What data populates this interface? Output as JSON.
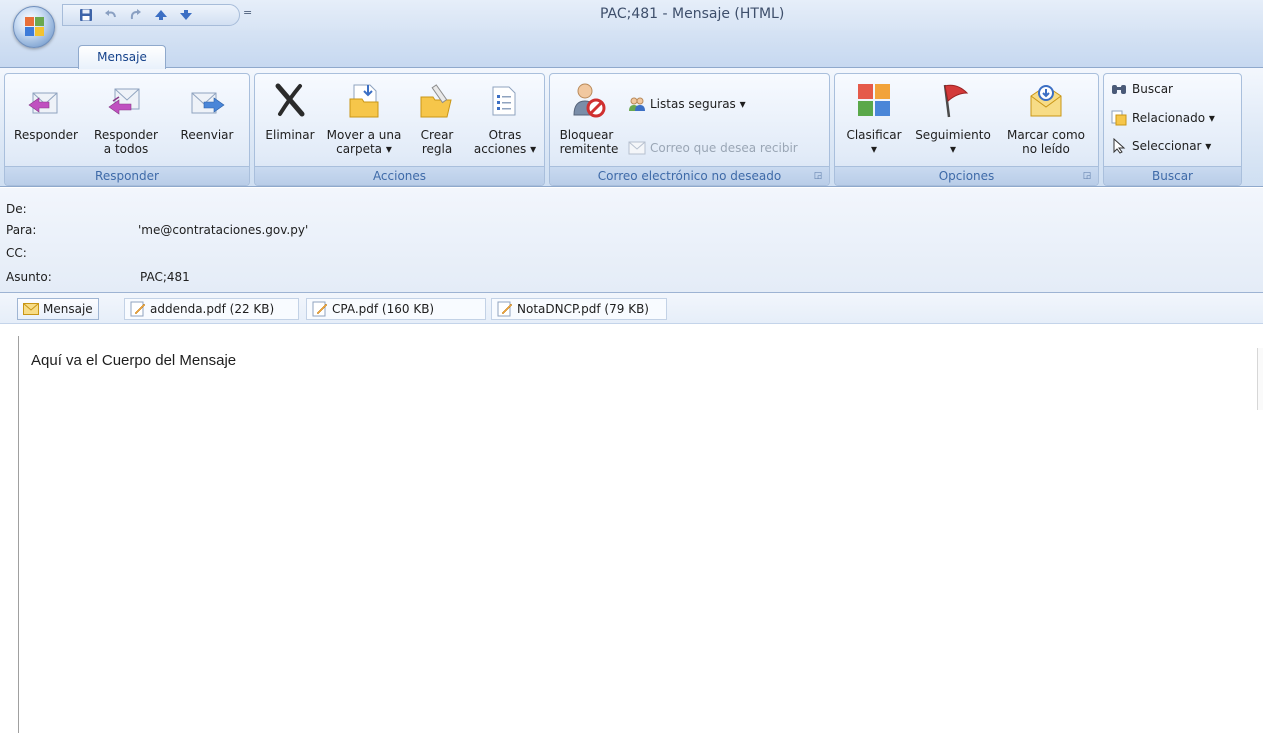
{
  "window": {
    "title": "PAC;481 - Mensaje (HTML)",
    "qat_more": "="
  },
  "tabs": [
    {
      "label": "Mensaje"
    }
  ],
  "ribbon": {
    "responder": {
      "label": "Responder",
      "buttons": [
        {
          "label": "Responder"
        },
        {
          "label": "Responder\na todos"
        },
        {
          "label": "Reenviar"
        }
      ]
    },
    "acciones": {
      "label": "Acciones",
      "buttons": [
        {
          "label": "Eliminar"
        },
        {
          "label": "Mover a una\ncarpeta ▾"
        },
        {
          "label": "Crear\nregla"
        },
        {
          "label": "Otras\nacciones ▾"
        }
      ]
    },
    "correo": {
      "label": "Correo electrónico no deseado",
      "bloquear": "Bloquear\nremitente",
      "listas": "Listas seguras ▾",
      "correo_deseado": "Correo que desea recibir"
    },
    "opciones": {
      "label": "Opciones",
      "buttons": [
        {
          "label": "Clasificar\n▾"
        },
        {
          "label": "Seguimiento\n▾"
        },
        {
          "label": "Marcar como\nno leído"
        }
      ]
    },
    "buscar": {
      "label": "Buscar",
      "items": [
        {
          "label": "Buscar"
        },
        {
          "label": "Relacionado ▾"
        },
        {
          "label": "Seleccionar ▾"
        }
      ]
    }
  },
  "header": {
    "de_label": "De:",
    "para_label": "Para:",
    "para_value": "'me@contrataciones.gov.py'",
    "cc_label": "CC:",
    "asunto_label": "Asunto:",
    "asunto_value": "PAC;481"
  },
  "attachments": [
    {
      "label": "Mensaje"
    },
    {
      "label": "addenda.pdf (22 KB)"
    },
    {
      "label": "CPA.pdf (160 KB)"
    },
    {
      "label": "NotaDNCP.pdf (79 KB)"
    }
  ],
  "body": {
    "text": "Aquí va el Cuerpo del Mensaje"
  },
  "icons": {
    "office": "office-logo-icon",
    "save": "save-icon",
    "undo": "undo-icon",
    "redo": "redo-icon",
    "up": "up-arrow-icon",
    "down": "down-arrow-icon"
  }
}
